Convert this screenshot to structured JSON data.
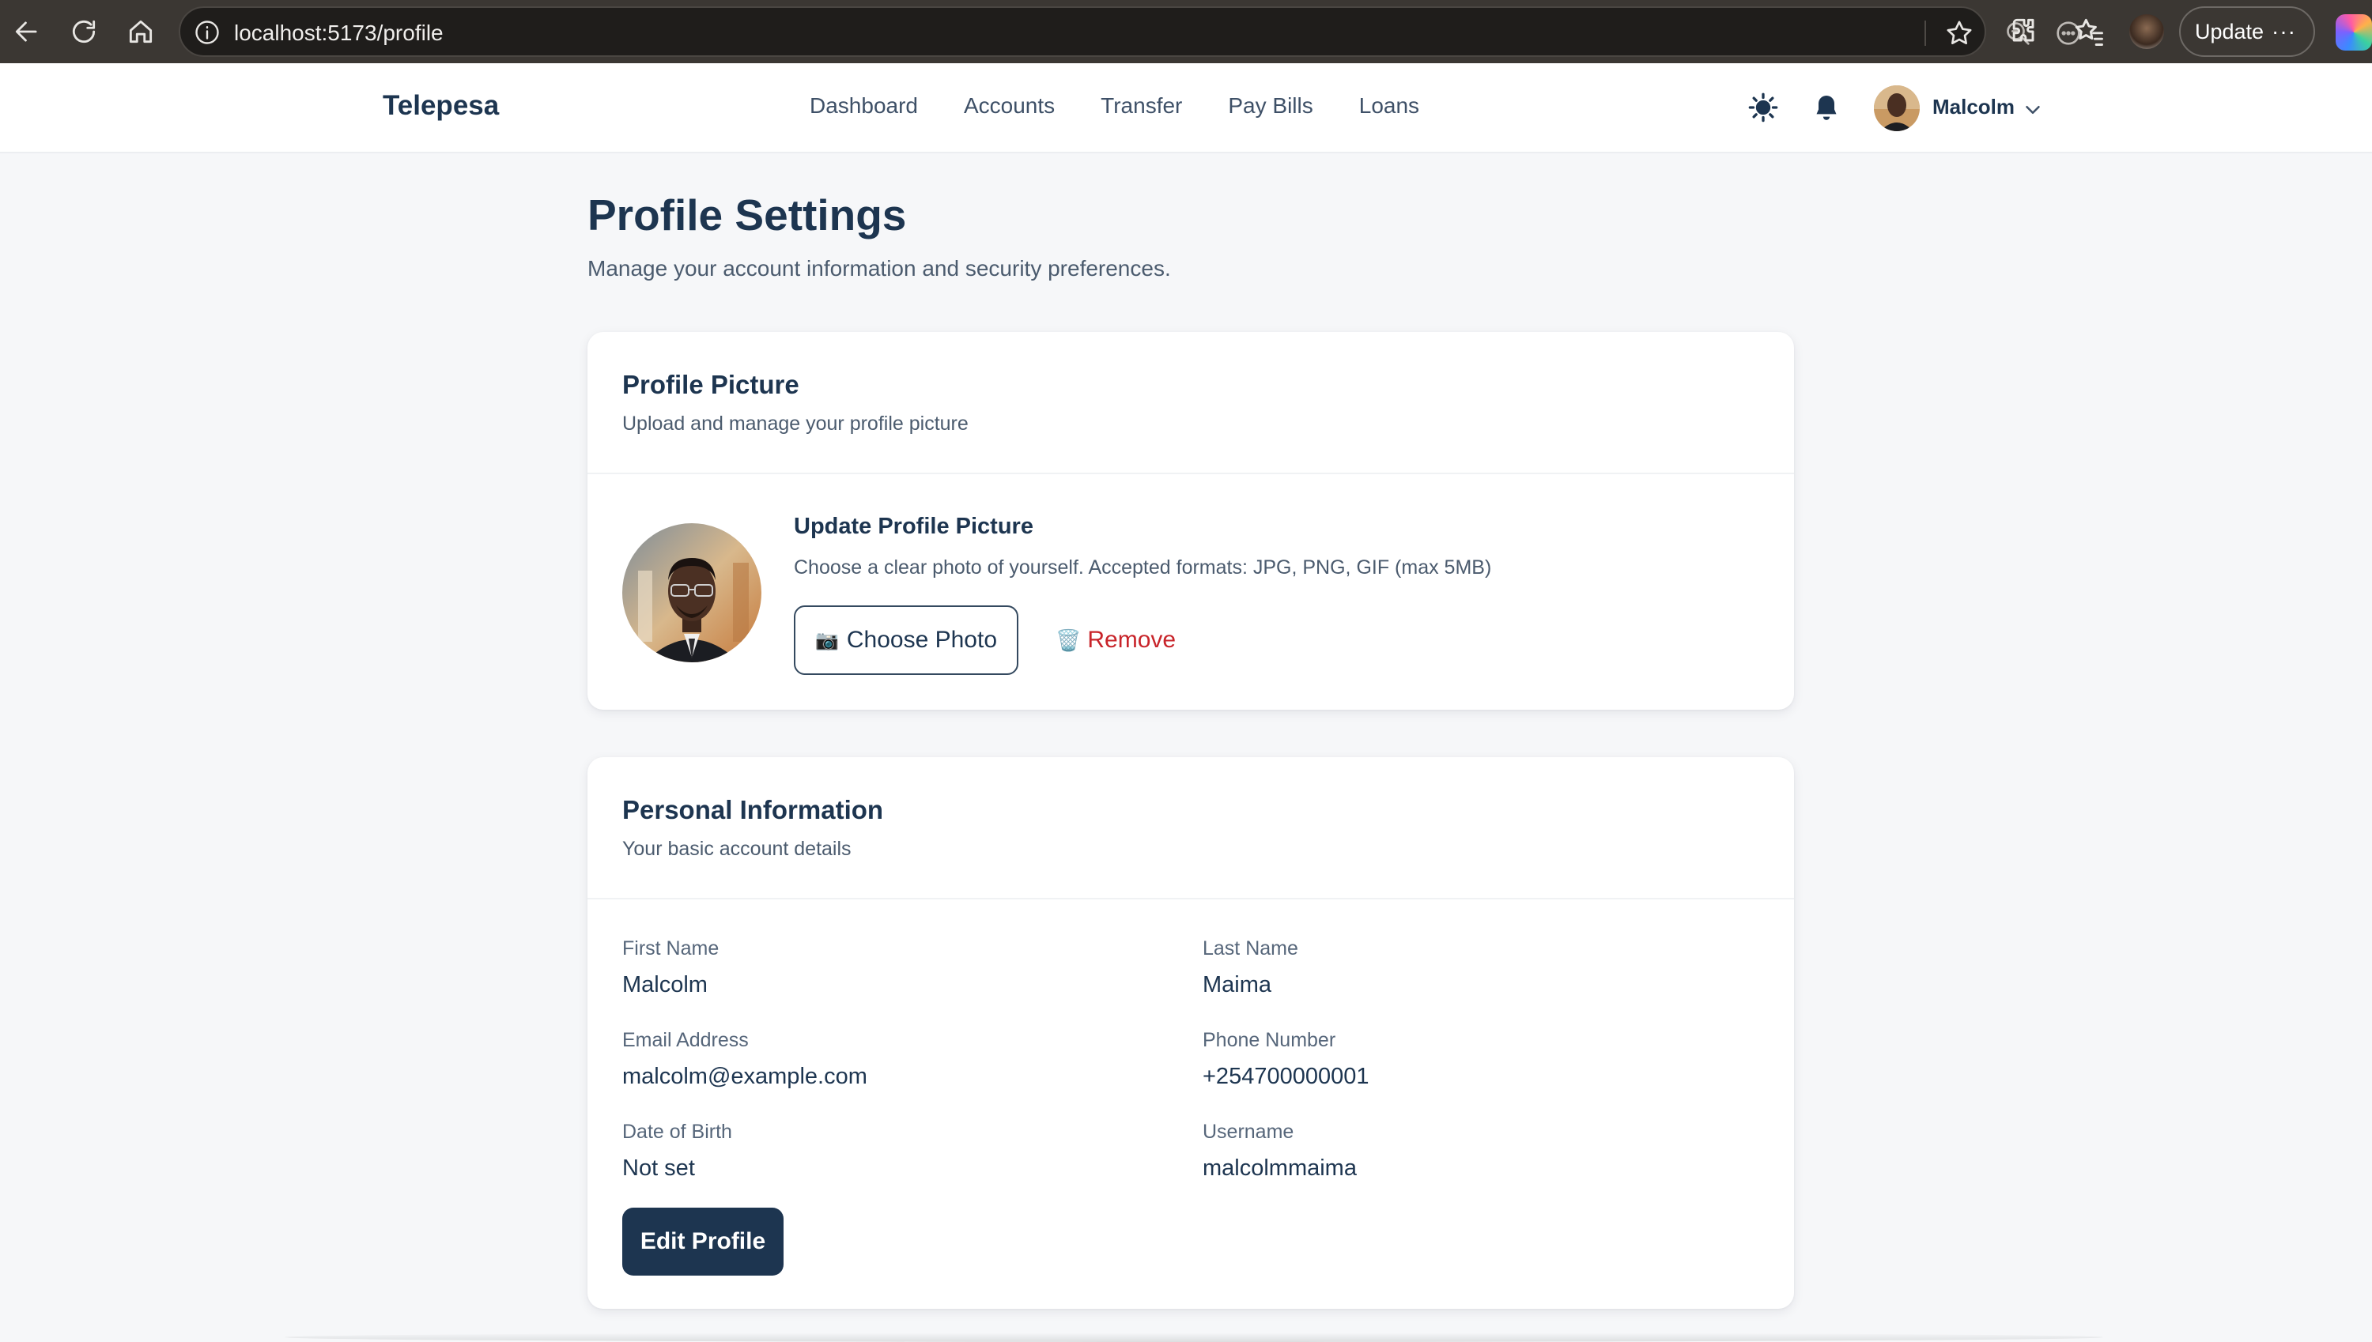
{
  "browser": {
    "url": "localhost:5173/profile",
    "update_label": "Update",
    "more_label": "···"
  },
  "navbar": {
    "brand": "Telepesa",
    "links": [
      {
        "label": "Dashboard"
      },
      {
        "label": "Accounts"
      },
      {
        "label": "Transfer"
      },
      {
        "label": "Pay Bills"
      },
      {
        "label": "Loans"
      }
    ],
    "username": "Malcolm"
  },
  "page": {
    "title": "Profile Settings",
    "subtitle": "Manage your account information and security preferences."
  },
  "profile_picture": {
    "title": "Profile Picture",
    "description": "Upload and manage your profile picture",
    "update_title": "Update Profile Picture",
    "update_description": "Choose a clear photo of yourself. Accepted formats: JPG, PNG, GIF (max 5MB)",
    "choose_icon": "📷",
    "choose_label": "Choose Photo",
    "remove_icon": "🗑️",
    "remove_label": "Remove"
  },
  "personal_info": {
    "title": "Personal Information",
    "description": "Your basic account details",
    "fields": [
      {
        "label": "First Name",
        "value": "Malcolm"
      },
      {
        "label": "Last Name",
        "value": "Maima"
      },
      {
        "label": "Email Address",
        "value": "malcolm@example.com"
      },
      {
        "label": "Phone Number",
        "value": "+254700000001"
      },
      {
        "label": "Date of Birth",
        "value": "Not set"
      },
      {
        "label": "Username",
        "value": "malcolmmaima"
      }
    ],
    "edit_label": "Edit Profile"
  },
  "colors": {
    "brand_navy": "#1d3550",
    "danger_red": "#c8242a",
    "page_bg": "#f6f7f9"
  }
}
